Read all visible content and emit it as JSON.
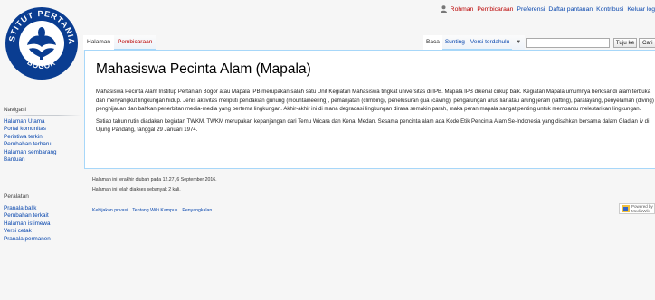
{
  "personal": {
    "user": "Rohman",
    "talk": "Pembicaraan",
    "preferences": "Preferensi",
    "watchlist": "Daftar pantauan",
    "contributions": "Kontribusi",
    "logout": "Keluar log"
  },
  "tabs": {
    "page": "Halaman",
    "discussion": "Pembicaraan",
    "read": "Baca",
    "edit": "Sunting",
    "history": "Versi terdahulu"
  },
  "search": {
    "value": "",
    "go": "Tuju ke",
    "search": "Cari"
  },
  "sidebar": {
    "navigation": {
      "heading": "Navigasi",
      "items": [
        "Halaman Utama",
        "Portal komunitas",
        "Peristiwa terkini",
        "Perubahan terbaru",
        "Halaman sembarang",
        "Bantuan"
      ]
    },
    "tools": {
      "heading": "Peralatan",
      "items": [
        "Pranala balik",
        "Perubahan terkait",
        "Halaman istimewa",
        "Versi cetak",
        "Pranala permanen"
      ]
    }
  },
  "content": {
    "title": "Mahasiswa Pecinta Alam (Mapala)",
    "paragraphs": [
      "Mahasiswa Pecinta Alam Institup Pertanian Bogor atau Mapala IPB merupakan salah satu Unit Kegiatan Mahasiswa tingkat universitas di IPB. Mapala IPB dikenal cukup baik. Kegiatan Mapala umumnya berkisar di alam terbuka dan menyangkut lingkungan hidup. Jenis aktivitas meliputi pendakian gunung (mountaineering), pemanjatan (climbing), penelusuran gua (caving), pengarungan arus liar atau arung jeram (rafting), paralayang, penyelaman (diving) penghijauan dan bahkan penerbitan media-media yang bertema lingkungan. Akhir-akhir ini di mana degradasi lingkungan dirasa semakin parah, maka peran mapala sangat penting untuk membantu melestarikan lingkungan.",
      "Setiap tahun rutin diadakan kegiatan TWKM. TWKM merupakan kepanjangan dari Temu Wicara dan Kenal Medan. Sesama pencinta alam ada Kode Etik Pencinta Alam Se-Indonesia yang disahkan bersama dalam Gladian iv di Ujung Pandang, tanggal 29 Januari 1974."
    ]
  },
  "footer": {
    "last_modified": "Halaman ini terakhir diubah pada 12.27, 6 September 2016.",
    "views": "Halaman ini telah diakses sebanyak 2 kali.",
    "links": [
      "Kebijakan privasi",
      "Tentang Wiki Kampus",
      "Penyangkalan"
    ],
    "powered_by": "Powered by MediaWiki"
  },
  "logo_text": "INSTITUT PERTANIAN BOGOR",
  "colors": {
    "link": "#0645ad",
    "new_link": "#ba0000",
    "logo_blue": "#0a3d91"
  }
}
